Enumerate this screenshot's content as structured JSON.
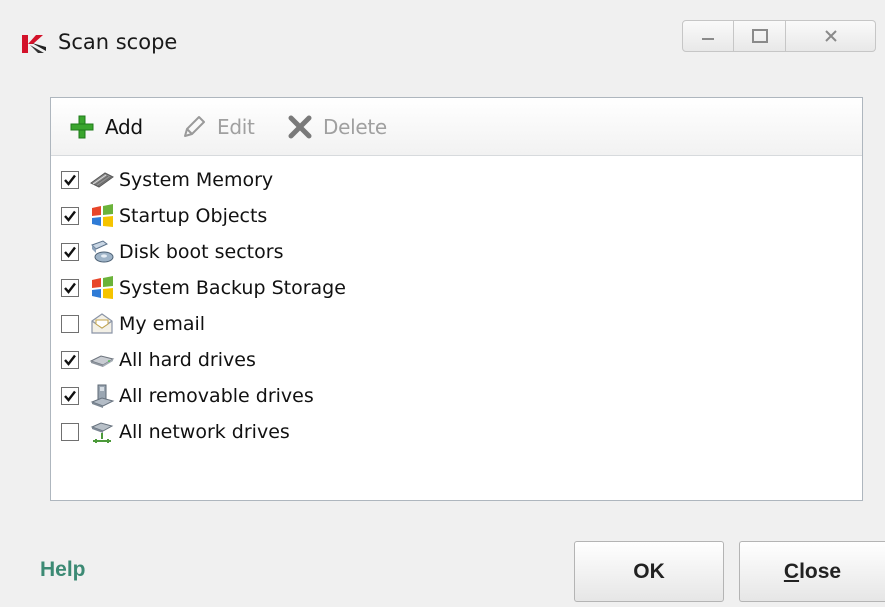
{
  "window": {
    "title": "Scan scope",
    "controls": {
      "minimize_icon": "minimize-icon",
      "maximize_icon": "maximize-icon",
      "close_icon": "close-icon"
    }
  },
  "toolbar": {
    "add_label": "Add",
    "edit_label": "Edit",
    "delete_label": "Delete"
  },
  "items": [
    {
      "label": "System Memory",
      "checked": true,
      "icon": "memory-chip-icon"
    },
    {
      "label": "Startup Objects",
      "checked": true,
      "icon": "windows-flag-icon"
    },
    {
      "label": "Disk boot sectors",
      "checked": true,
      "icon": "disk-boot-icon"
    },
    {
      "label": "System Backup Storage",
      "checked": true,
      "icon": "windows-flag-icon"
    },
    {
      "label": "My email",
      "checked": false,
      "icon": "email-icon"
    },
    {
      "label": "All hard drives",
      "checked": true,
      "icon": "hard-drive-icon"
    },
    {
      "label": "All removable drives",
      "checked": true,
      "icon": "removable-drive-icon"
    },
    {
      "label": "All network drives",
      "checked": false,
      "icon": "network-drive-icon"
    }
  ],
  "footer": {
    "help_label": "Help",
    "ok_label": "OK",
    "close_label_first": "C",
    "close_label_rest": "lose"
  },
  "colors": {
    "accent_help": "#3c8a74",
    "brand_red": "#d3122a",
    "add_green": "#3aa52e"
  }
}
